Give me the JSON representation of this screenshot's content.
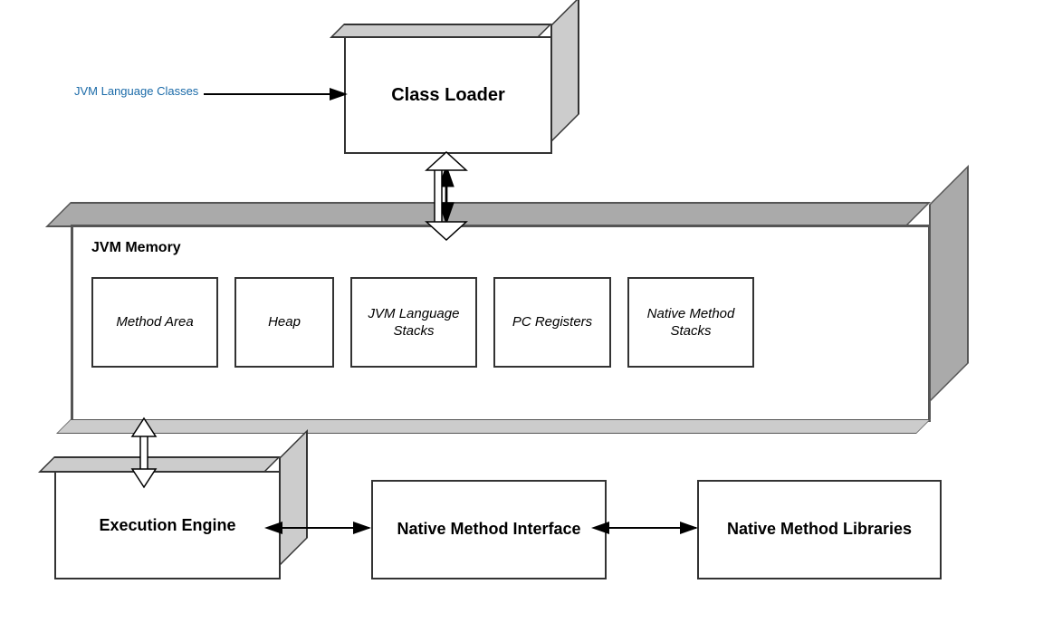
{
  "classLoader": {
    "label": "Class Loader"
  },
  "jvmLanguageClasses": {
    "label": "JVM Language Classes"
  },
  "jvmMemory": {
    "title": "JVM Memory",
    "boxes": [
      {
        "label": "Method Area"
      },
      {
        "label": "Heap"
      },
      {
        "label": "JVM Language\nStacks"
      },
      {
        "label": "PC Registers"
      },
      {
        "label": "Native Method\nStacks"
      }
    ]
  },
  "executionEngine": {
    "label": "Execution Engine"
  },
  "nativeMethodInterface": {
    "label": "Native Method Interface"
  },
  "nativeMethodLibraries": {
    "label": "Native Method Libraries"
  }
}
